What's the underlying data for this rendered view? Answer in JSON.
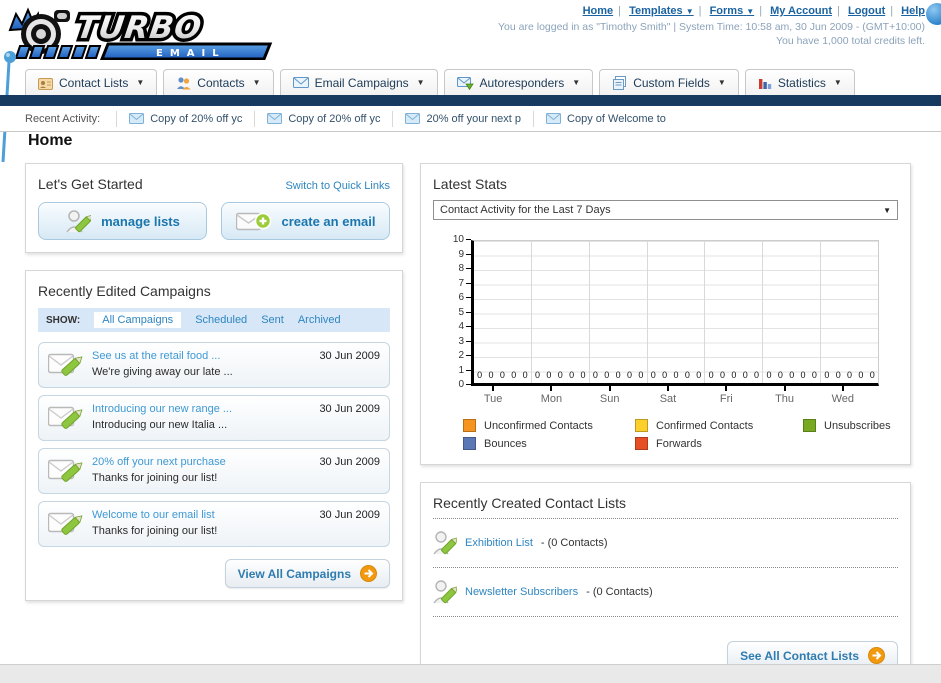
{
  "header": {
    "logo_line1": "TURBO",
    "logo_line2": "E M A I L",
    "nav_links": [
      {
        "label": "Home",
        "dropdown": false
      },
      {
        "label": "Templates",
        "dropdown": true
      },
      {
        "label": "Forms",
        "dropdown": true
      },
      {
        "label": "My Account",
        "dropdown": false
      },
      {
        "label": "Logout",
        "dropdown": false
      },
      {
        "label": "Help",
        "dropdown": false
      }
    ],
    "login_text": "You are logged in as \"Timothy Smith\" | System Time: 10:58 am, 30 Jun 2009 - (GMT+10:00)",
    "credits_text": "You have 1,000 total credits left."
  },
  "tabs": [
    {
      "label": "Contact Lists",
      "icon": "contact-lists-icon"
    },
    {
      "label": "Contacts",
      "icon": "contacts-icon"
    },
    {
      "label": "Email Campaigns",
      "icon": "email-campaigns-icon"
    },
    {
      "label": "Autoresponders",
      "icon": "autoresponders-icon"
    },
    {
      "label": "Custom Fields",
      "icon": "custom-fields-icon"
    },
    {
      "label": "Statistics",
      "icon": "statistics-icon"
    }
  ],
  "recent_activity": {
    "label": "Recent Activity:",
    "items": [
      "Copy of 20% off yc",
      "Copy of 20% off yc",
      "20% off your next p",
      "Copy of Welcome to"
    ]
  },
  "page_title": "Home",
  "get_started": {
    "title": "Let's Get Started",
    "switch_link": "Switch to Quick Links",
    "buttons": [
      {
        "label": "manage lists",
        "icon": "person-pencil-icon"
      },
      {
        "label": "create an email",
        "icon": "envelope-plus-icon"
      }
    ]
  },
  "campaigns": {
    "title": "Recently Edited Campaigns",
    "show_label": "SHOW:",
    "active_filter": "All Campaigns",
    "filters": [
      "Scheduled",
      "Sent",
      "Archived"
    ],
    "items": [
      {
        "title": "See us at the retail food ...",
        "subtitle": "We're giving away our late ...",
        "date": "30 Jun 2009"
      },
      {
        "title": "Introducing our new range ...",
        "subtitle": "Introducing our new Italia ...",
        "date": "30 Jun 2009"
      },
      {
        "title": "20% off your next purchase",
        "subtitle": "Thanks for joining our list!",
        "date": "30 Jun 2009"
      },
      {
        "title": "Welcome to our email list",
        "subtitle": "Thanks for joining our list!",
        "date": "30 Jun 2009"
      }
    ],
    "view_all_label": "View All Campaigns"
  },
  "stats": {
    "title": "Latest Stats",
    "selector_value": "Contact Activity for the Last 7 Days",
    "chart_data": {
      "type": "bar",
      "title": "Contact Activity for the Last 7 Days",
      "categories": [
        "Tue",
        "Mon",
        "Sun",
        "Sat",
        "Fri",
        "Thu",
        "Wed"
      ],
      "series": [
        {
          "name": "Unconfirmed Contacts",
          "color": "#f5951f",
          "values": [
            0,
            0,
            0,
            0,
            0,
            0,
            0
          ]
        },
        {
          "name": "Confirmed Contacts",
          "color": "#fccf2b",
          "values": [
            0,
            0,
            0,
            0,
            0,
            0,
            0
          ]
        },
        {
          "name": "Unsubscribes",
          "color": "#79a823",
          "values": [
            0,
            0,
            0,
            0,
            0,
            0,
            0
          ]
        },
        {
          "name": "Bounces",
          "color": "#5a78b6",
          "values": [
            0,
            0,
            0,
            0,
            0,
            0,
            0
          ]
        },
        {
          "name": "Forwards",
          "color": "#e64f25",
          "values": [
            0,
            0,
            0,
            0,
            0,
            0,
            0
          ]
        }
      ],
      "ylim": [
        0,
        10
      ],
      "ytick_step": 1,
      "grid": true,
      "legend_position": "bottom"
    }
  },
  "contact_lists": {
    "title": "Recently Created Contact Lists",
    "items": [
      {
        "name": "Exhibition List",
        "detail": "- (0 Contacts)"
      },
      {
        "name": "Newsletter Subscribers",
        "detail": "- (0 Contacts)"
      }
    ],
    "see_all_label": "See All Contact Lists"
  }
}
